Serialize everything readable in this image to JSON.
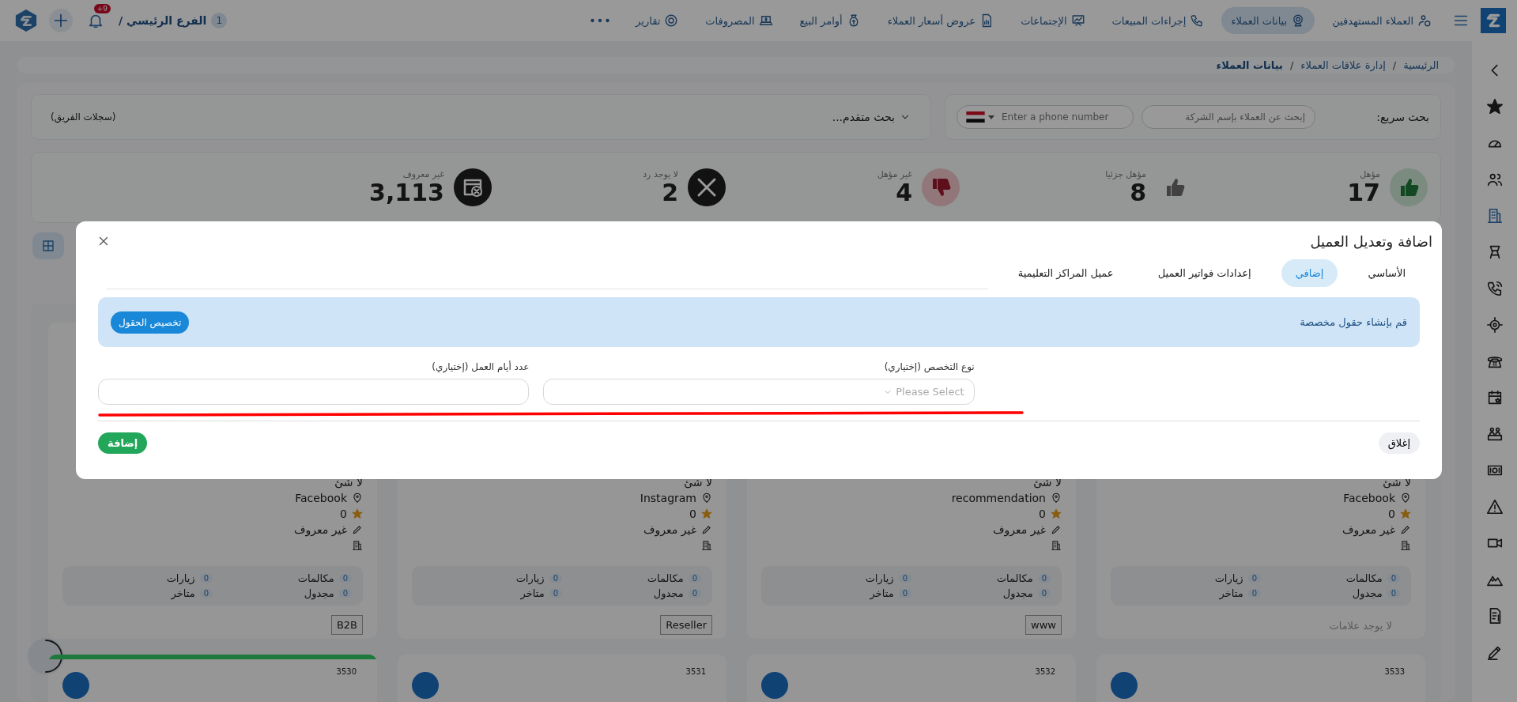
{
  "topbar": {
    "nav": [
      {
        "label": "العملاء المستهدفين",
        "selected": false
      },
      {
        "label": "بيانات العملاء",
        "selected": true
      },
      {
        "label": "إجراءات المبيعات",
        "selected": false
      },
      {
        "label": "الإجتماعات",
        "selected": false
      },
      {
        "label": "عروض أسعار العملاء",
        "selected": false
      },
      {
        "label": "أوامر البيع",
        "selected": false
      },
      {
        "label": "المصروفات",
        "selected": false
      },
      {
        "label": "تقارير",
        "selected": false
      }
    ],
    "branch": {
      "count": "1",
      "name": "الفرع الرئيسي /"
    },
    "notifications": "+9"
  },
  "breadcrumb": [
    {
      "kind": "link",
      "text": "الرئيسية"
    },
    {
      "kind": "separator",
      "text": "/"
    },
    {
      "kind": "link",
      "text": "إدارة علاقات العملاء"
    },
    {
      "kind": "separator",
      "text": "/"
    },
    {
      "kind": "current",
      "text": "بيانات العملاء"
    }
  ],
  "quick_search": {
    "label": "بحث سريع:",
    "company_placeholder": "إبحث عن العملاء بإسم الشركة",
    "phone_placeholder": "Enter a phone number",
    "advanced": "بحث متقدم...",
    "team_records": "(سجلات الفريق)"
  },
  "stats": [
    {
      "kind": "qualified",
      "label": "مؤهل",
      "value": "17"
    },
    {
      "kind": "partial",
      "label": "مؤهل جزئيا",
      "value": "8"
    },
    {
      "kind": "unqualified",
      "label": "غير مؤهل",
      "value": "4"
    },
    {
      "kind": "no_reply",
      "label": "لا يوجد رد",
      "value": "2"
    },
    {
      "kind": "unknown",
      "label": "غير معروف",
      "value": "3,113"
    }
  ],
  "modal": {
    "title": "اضافة وتعديل العميل",
    "tabs": [
      {
        "label": "الأساسي",
        "selected": false
      },
      {
        "label": "إضافي",
        "selected": true
      },
      {
        "label": "إعدادات فواتير العميل",
        "selected": false
      },
      {
        "label": "عميل المراكز التعليمية",
        "selected": false
      }
    ],
    "banner": {
      "text": "قم بإنشاء حقول مخصصة",
      "button": "تخصيص الحقول"
    },
    "fields": [
      {
        "kind": "select",
        "label": "نوع التخصص (إختياري)",
        "placeholder": "Please Select"
      },
      {
        "kind": "input",
        "label": "عدد أيام العمل (إختياري)"
      }
    ],
    "close_button": "إغلاق",
    "add_button": "إضافة"
  },
  "cards": [
    {
      "note": "لا شئ",
      "source": "Facebook",
      "rating": "0",
      "owner": "غير معروف",
      "counters": [
        {
          "label": "مكالمات",
          "count": "0"
        },
        {
          "label": "زيارات",
          "count": "0"
        },
        {
          "label": "مجدول",
          "count": "0"
        },
        {
          "label": "متاخر",
          "count": "0"
        }
      ],
      "no_tags": "لا يوجد علامات"
    },
    {
      "note": "لا شئ",
      "source": "recommendation",
      "rating": "0",
      "owner": "غير معروف",
      "counters": [
        {
          "label": "مكالمات",
          "count": "0"
        },
        {
          "label": "زيارات",
          "count": "0"
        },
        {
          "label": "مجدول",
          "count": "0"
        },
        {
          "label": "متاخر",
          "count": "0"
        }
      ],
      "tags": [
        "www"
      ]
    },
    {
      "note": "لا شئ",
      "source": "Instagram",
      "rating": "0",
      "owner": "غير معروف",
      "counters": [
        {
          "label": "مكالمات",
          "count": "0"
        },
        {
          "label": "زيارات",
          "count": "0"
        },
        {
          "label": "مجدول",
          "count": "0"
        },
        {
          "label": "متاخر",
          "count": "0"
        }
      ],
      "tags": [
        "Reseller"
      ]
    },
    {
      "note": "لا شئ",
      "source": "Facebook",
      "rating": "0",
      "owner": "غير معروف",
      "counters": [
        {
          "label": "مكالمات",
          "count": "0"
        },
        {
          "label": "زيارات",
          "count": "0"
        },
        {
          "label": "مجدول",
          "count": "0"
        },
        {
          "label": "متاخر",
          "count": "0"
        }
      ],
      "tags": [
        "B2B"
      ]
    }
  ],
  "next_cards": [
    {
      "number": "3533"
    },
    {
      "number": "3532"
    },
    {
      "number": "3531"
    },
    {
      "number": "3530",
      "color": "#1d7a3c"
    }
  ]
}
